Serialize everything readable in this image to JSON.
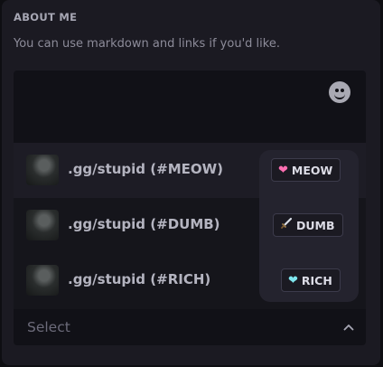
{
  "section": {
    "title": "ABOUT ME",
    "description": "You can use markdown and links if you'd like."
  },
  "emoji_button": {
    "icon": "smiley-icon"
  },
  "options": [
    {
      "label": ".gg/stupid (#MEOW)",
      "tag": "MEOW",
      "tag_icon": "pink-heart-icon"
    },
    {
      "label": ".gg/stupid (#DUMB)",
      "tag": "DUMB",
      "tag_icon": "sword-icon"
    },
    {
      "label": ".gg/stupid (#RICH)",
      "tag": "RICH",
      "tag_icon": "cyan-heart-icon"
    }
  ],
  "select": {
    "placeholder": "Select",
    "icon": "chevron-up-icon"
  }
}
